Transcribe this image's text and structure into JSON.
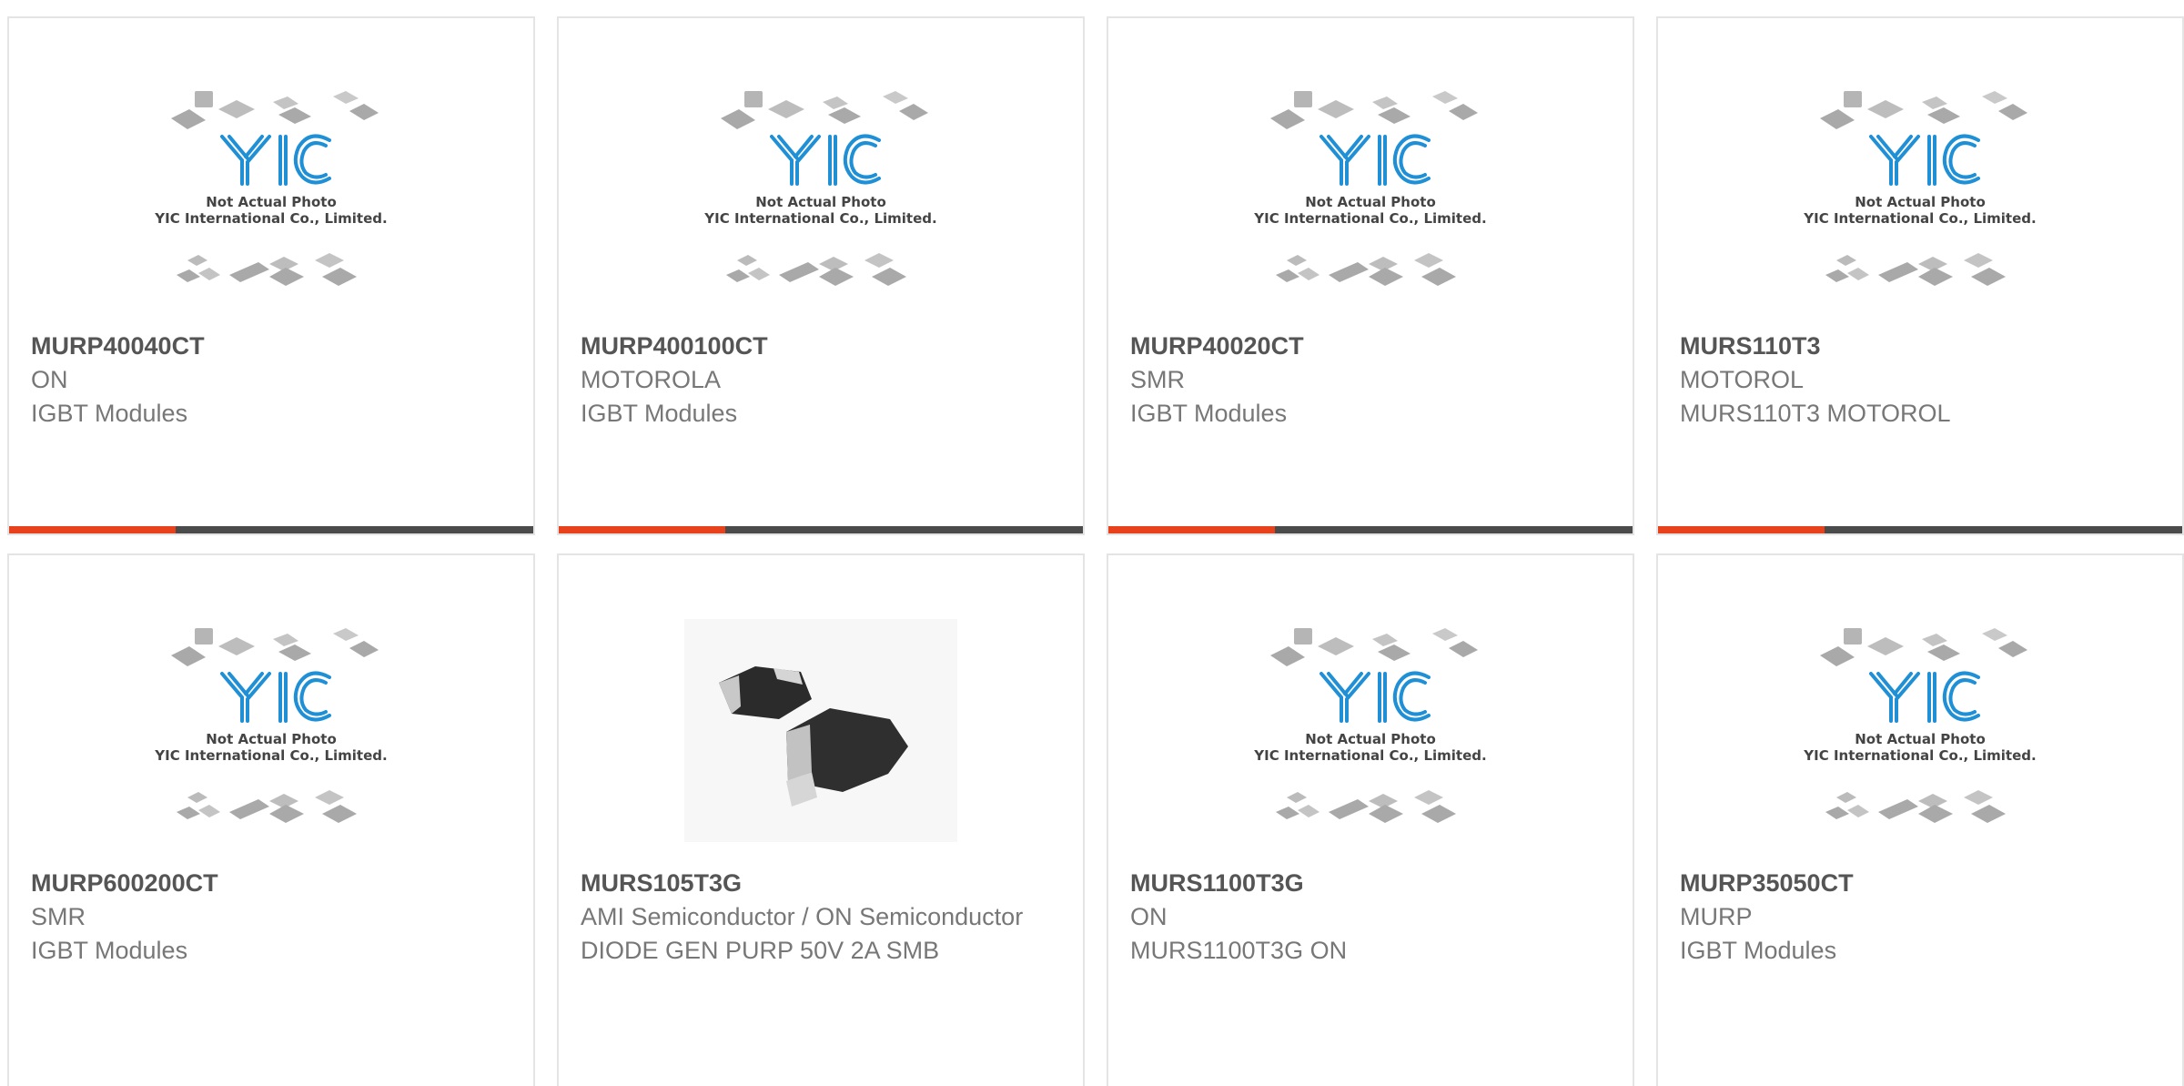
{
  "placeholder": {
    "brand": "YIC",
    "caption_line1": "Not Actual Photo",
    "caption_line2": "YIC International Co., Limited."
  },
  "colors": {
    "accent": "#e8421c",
    "bar": "#4b4b4b",
    "brand_blue": "#1f8fd6"
  },
  "products": [
    {
      "part": "MURP40040CT",
      "maker": "ON",
      "desc": "IGBT Modules",
      "image": "placeholder-photo"
    },
    {
      "part": "MURP400100CT",
      "maker": "MOTOROLA",
      "desc": "IGBT Modules",
      "image": "placeholder-photo"
    },
    {
      "part": "MURP40020CT",
      "maker": "SMR",
      "desc": "IGBT Modules",
      "image": "placeholder-photo"
    },
    {
      "part": "MURS110T3",
      "maker": "MOTOROL",
      "desc": "MURS110T3 MOTOROL",
      "image": "placeholder-photo"
    },
    {
      "part": "MURP600200CT",
      "maker": "SMR",
      "desc": "IGBT Modules",
      "image": "placeholder-photo"
    },
    {
      "part": "MURS105T3G",
      "maker": "AMI Semiconductor / ON Semiconductor",
      "desc": "DIODE GEN PURP 50V 2A SMB",
      "image": "smb-diode-photo"
    },
    {
      "part": "MURS1100T3G",
      "maker": "ON",
      "desc": "MURS1100T3G ON",
      "image": "placeholder-photo"
    },
    {
      "part": "MURP35050CT",
      "maker": "MURP",
      "desc": "IGBT Modules",
      "image": "placeholder-photo"
    }
  ]
}
